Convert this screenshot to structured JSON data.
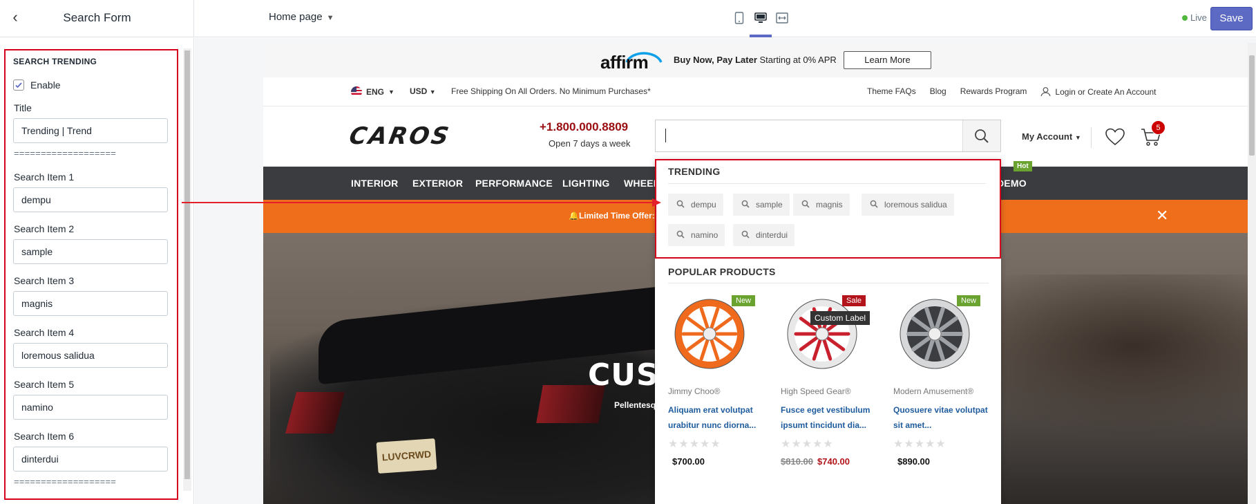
{
  "editor": {
    "sidebar_title": "Search Form",
    "page_select": "Home page",
    "live_label": "Live",
    "save_label": "Save"
  },
  "settings": {
    "section_heading": "SEARCH TRENDING",
    "enable_label": "Enable",
    "enable_checked": true,
    "title_label": "Title",
    "title_value": "Trending | Trend",
    "divider": "===================",
    "items": [
      {
        "label": "Search Item 1",
        "value": "dempu"
      },
      {
        "label": "Search Item 2",
        "value": "sample"
      },
      {
        "label": "Search Item 3",
        "value": "magnis"
      },
      {
        "label": "Search Item 4",
        "value": "loremous salidua"
      },
      {
        "label": "Search Item 5",
        "value": "namino"
      },
      {
        "label": "Search Item 6",
        "value": "dinterdui"
      }
    ]
  },
  "store": {
    "affirm": {
      "logo": "affirm",
      "bold": "Buy Now, Pay Later",
      "text": " Starting at 0% APR",
      "button": "Learn More"
    },
    "topbar": {
      "language": "ENG",
      "currency": "USD",
      "shipping": "Free Shipping On All Orders. No Minimum Purchases*",
      "links": [
        "Theme FAQs",
        "Blog",
        "Rewards Program"
      ],
      "login": "Login or Create An Account"
    },
    "header": {
      "logo": "CAROS",
      "phone": "+1.800.000.8809",
      "hours": "Open 7 days a week",
      "account": "My Account",
      "cart_count": "5"
    },
    "nav": {
      "items": [
        "INTERIOR",
        "EXTERIOR",
        "PERFORMANCE",
        "LIGHTING",
        "WHEEL",
        "DEMO"
      ],
      "hot_badge": "Hot"
    },
    "promo": {
      "text": "Limited Time Offer:",
      "close": "✕"
    },
    "hero": {
      "title": "CUST",
      "subtitle": "Pellentesq",
      "plate": "LUVCRWD"
    },
    "dropdown": {
      "trending_heading": "TRENDING",
      "trending": [
        "dempu",
        "sample",
        "magnis",
        "loremous salidua",
        "namino",
        "dinterdui"
      ],
      "popular_heading": "POPULAR PRODUCTS",
      "custom_label": "Custom Label",
      "products": [
        {
          "badge": "New",
          "badge_color": "#6aa32f",
          "brand": "Jimmy Choo®",
          "name": "Aliquam erat volutpat urabitur nunc diorna...",
          "old_price": "",
          "price": "$700.00",
          "rating": 0,
          "wheel_color": "#f06a1d"
        },
        {
          "badge": "Sale",
          "badge_color": "#b3141b",
          "brand": "High Speed Gear®",
          "name": "Fusce eget vestibulum ipsumt tincidunt dia...",
          "old_price": "$810.00",
          "price": "$740.00",
          "rating": 0,
          "wheel_color": "#c8202c"
        },
        {
          "badge": "New",
          "badge_color": "#6aa32f",
          "brand": "Modern Amusement®",
          "name": "Quosuere vitae volutpat sit amet...",
          "old_price": "",
          "price": "$890.00",
          "rating": 0,
          "wheel_color": "#9ea2a6"
        }
      ]
    }
  }
}
